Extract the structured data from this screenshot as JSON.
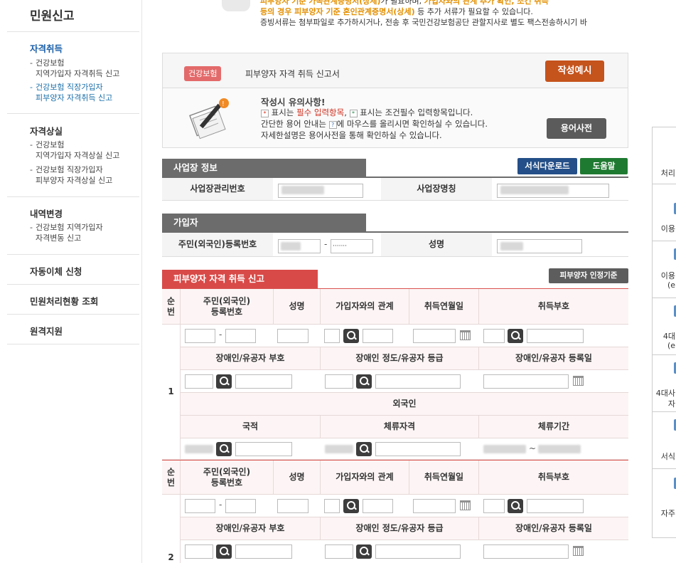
{
  "sidebar": {
    "title": "민원신고",
    "groups": [
      {
        "heading": "자격취득",
        "items": [
          {
            "line1": "건강보험",
            "line2": "지역가입자 자격취득 신고"
          },
          {
            "line1": "건강보험 직장가입자",
            "line2": "피부양자 자격취득 신고"
          }
        ]
      },
      {
        "heading": "자격상실",
        "items": [
          {
            "line1": "건강보험",
            "line2": "지역가입자 자격상실 신고"
          },
          {
            "line1": "건강보험 직장가입자",
            "line2": "피부양자 자격상실 신고"
          }
        ]
      },
      {
        "heading": "내역변경",
        "items": [
          {
            "line1": "건강보험 지역가입자",
            "line2": "자격변동 신고"
          }
        ]
      }
    ],
    "links": [
      "자동이체 신청",
      "민원처리현황 조회",
      "원격지원"
    ]
  },
  "notice": {
    "line1_a": "피부양자 기준 가족관계증명서(상세)",
    "line1_b": "가 필요하며, ",
    "line1_c": "가입자와의 관계 추가 확인, 조건 취득",
    "line2_a": "등의 경우 피부양자 기준 혼인관계증명서(상세)",
    "line2_b": " 등 추가 서류가 필요할 수 있습니다.",
    "line3": "증빙서류는 첨부파일로 추가하시거나, 전송 후 국민건강보험공단 관할지사로 별도 팩스전송하시기 바"
  },
  "form": {
    "badge": "건강보험",
    "name": "피부양자 자격 취득 신고서",
    "example_button": "작성예시",
    "caution_title": "작성시 유의사항!",
    "caution_1a": "표시는 ",
    "caution_1b": "필수 입력항목",
    "caution_1c": ", ",
    "caution_1d": "표시는 조건필수 입력항목입니다.",
    "caution_2a": "간단한 용어 안내는 ",
    "caution_2b": "에 마우스를 올리시면 확인하실 수 있습니다.",
    "caution_3": "자세한설명은 용어사전을 통해 확인하실 수 있습니다.",
    "dict_button": "용어사전",
    "mark_req": "*",
    "mark_cond": "*",
    "mark_q": "?"
  },
  "workplace": {
    "section": "사업장 정보",
    "download_button": "서식다운로드",
    "help_button": "도움말",
    "mgmt_no_label": "사업장관리번호",
    "name_label": "사업장명칭"
  },
  "subscriber": {
    "section": "가입자",
    "rrn_label": "주민(외국인)등록번호",
    "rrn_dash": "-",
    "rrn_mask": "·······",
    "name_label": "성명"
  },
  "dependent": {
    "section": "피부양자 자격 취득 신고",
    "criteria_button": "피부양자 인정기준",
    "headers": {
      "no": [
        "순",
        "번"
      ],
      "rrn": [
        "주민(외국인)",
        "등록번호"
      ],
      "name": "성명",
      "relation": "가입자와의 관계",
      "acq_date": "취득연월일",
      "acq_code": "취득부호",
      "disabled_code": "장애인/유공자 부호",
      "disabled_grade": "장애인 정도/유공자 등급",
      "disabled_date": "장애인/유공자 등록일",
      "foreigner": "외국인",
      "nationality": "국적",
      "stay_status": "체류자격",
      "stay_period": "체류기간"
    },
    "rows": [
      "1",
      "2"
    ],
    "dash": "-",
    "tilde": "~"
  },
  "right_panel": [
    "처리",
    "이용",
    "이용",
    "(e",
    "4대",
    "(e",
    "4대사",
    "자",
    "서식",
    "자주"
  ]
}
